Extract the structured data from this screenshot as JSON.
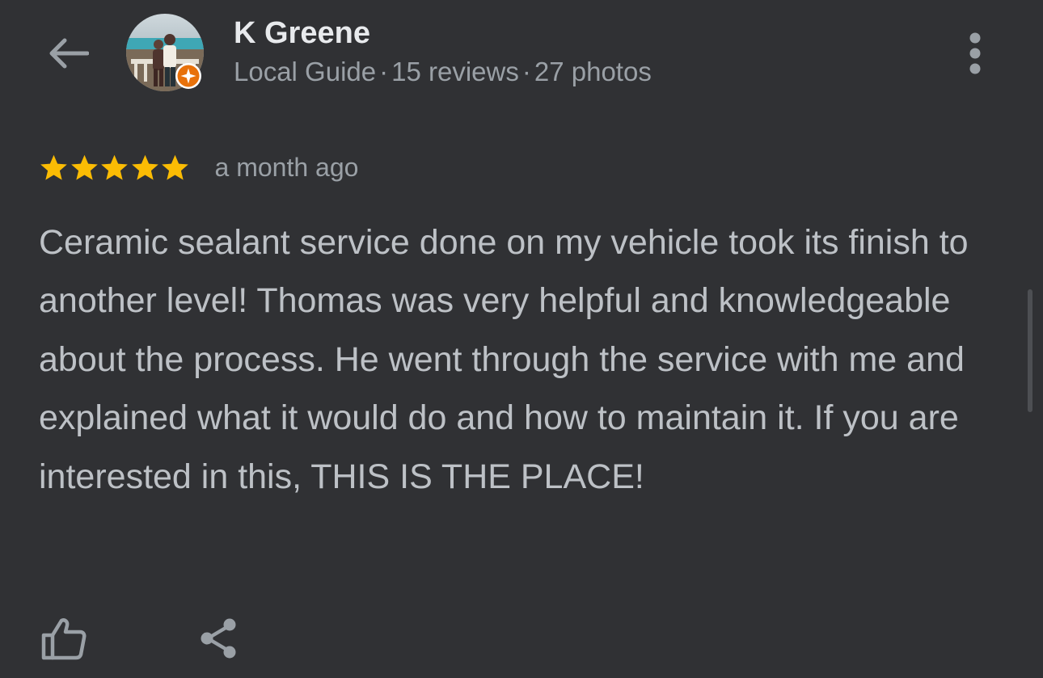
{
  "header": {
    "back_icon": "arrow-back-icon",
    "more_icon": "more-vert-icon"
  },
  "reviewer": {
    "name": "K Greene",
    "badge": "Local Guide",
    "separator": "·",
    "reviews": "15 reviews",
    "photos": "27 photos",
    "badge_icon": "local-guide-star-icon",
    "badge_color": "#e8710a"
  },
  "review": {
    "stars": 5,
    "star_color": "#fbbc04",
    "time": "a month ago",
    "text": "Ceramic sealant service done on my vehicle took its finish to another level! Thomas was very helpful and knowledgeable about the process. He went through the service with me and explained what it would do and how to maintain it. If you are interested in this, THIS IS THE PLACE!"
  },
  "actions": {
    "like_icon": "thumb-up-icon",
    "share_icon": "share-icon"
  },
  "colors": {
    "background": "#303134",
    "primary_text": "#e8eaed",
    "secondary_text": "#9aa0a6",
    "body_text": "#bdc1c6"
  }
}
